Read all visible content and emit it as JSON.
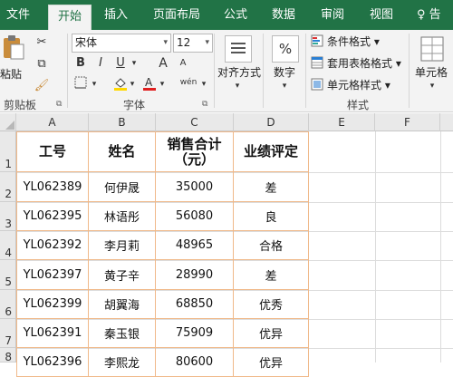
{
  "ribbon": {
    "tabs": [
      "文件",
      "开始",
      "插入",
      "页面布局",
      "公式",
      "数据",
      "审阅",
      "视图"
    ],
    "active_tab": "开始",
    "help_hint": "♀ 告",
    "clipboard": {
      "paste": "粘贴",
      "group": "剪贴板"
    },
    "font": {
      "name": "宋体",
      "size": "12",
      "group": "字体",
      "bold": "B",
      "italic": "I",
      "underline": "U",
      "grow": "A",
      "shrink": "A",
      "phonetic": "wén"
    },
    "alignment": {
      "label": "对齐方式"
    },
    "number": {
      "label": "数字",
      "symbol": "%"
    },
    "styles": {
      "conditional": "条件格式",
      "table": "套用表格格式",
      "cell": "单元格样式",
      "group": "样式"
    },
    "cells": {
      "label": "单元格"
    }
  },
  "sheet": {
    "columns": [
      "A",
      "B",
      "C",
      "D",
      "E",
      "F"
    ],
    "row_numbers": [
      "1",
      "2",
      "3",
      "4",
      "5",
      "6",
      "7",
      "8"
    ],
    "headers": [
      "工号",
      "姓名",
      "销售合计\n（元）",
      "业绩评定"
    ],
    "rows": [
      [
        "YL062389",
        "何伊晟",
        "35000",
        "差"
      ],
      [
        "YL062395",
        "林语彤",
        "56080",
        "良"
      ],
      [
        "YL062392",
        "李月莉",
        "48965",
        "合格"
      ],
      [
        "YL062397",
        "黄子辛",
        "28990",
        "差"
      ],
      [
        "YL062399",
        "胡翼海",
        "68850",
        "优秀"
      ],
      [
        "YL062391",
        "秦玉银",
        "75909",
        "优异"
      ],
      [
        "YL062396",
        "李熙龙",
        "80600",
        "优异"
      ]
    ]
  },
  "colors": {
    "ribbon_green": "#217346",
    "table_border": "#f0b98a"
  }
}
